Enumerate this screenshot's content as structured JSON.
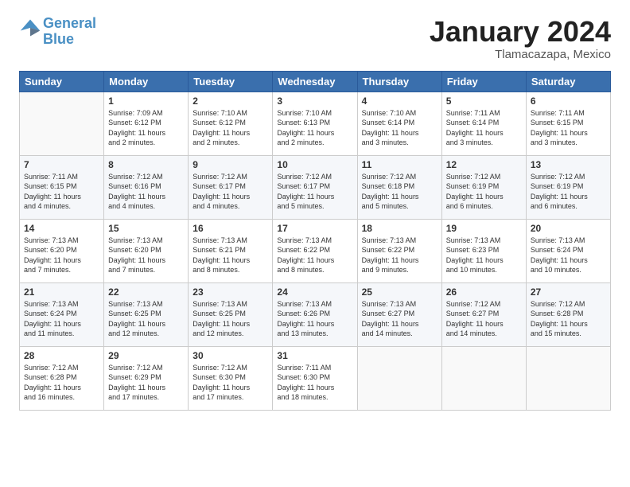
{
  "header": {
    "logo_line1": "General",
    "logo_line2": "Blue",
    "month_title": "January 2024",
    "location": "Tlamacazapa, Mexico"
  },
  "days_of_week": [
    "Sunday",
    "Monday",
    "Tuesday",
    "Wednesday",
    "Thursday",
    "Friday",
    "Saturday"
  ],
  "weeks": [
    [
      {
        "day": "",
        "content": ""
      },
      {
        "day": "1",
        "content": "Sunrise: 7:09 AM\nSunset: 6:12 PM\nDaylight: 11 hours\nand 2 minutes."
      },
      {
        "day": "2",
        "content": "Sunrise: 7:10 AM\nSunset: 6:12 PM\nDaylight: 11 hours\nand 2 minutes."
      },
      {
        "day": "3",
        "content": "Sunrise: 7:10 AM\nSunset: 6:13 PM\nDaylight: 11 hours\nand 2 minutes."
      },
      {
        "day": "4",
        "content": "Sunrise: 7:10 AM\nSunset: 6:14 PM\nDaylight: 11 hours\nand 3 minutes."
      },
      {
        "day": "5",
        "content": "Sunrise: 7:11 AM\nSunset: 6:14 PM\nDaylight: 11 hours\nand 3 minutes."
      },
      {
        "day": "6",
        "content": "Sunrise: 7:11 AM\nSunset: 6:15 PM\nDaylight: 11 hours\nand 3 minutes."
      }
    ],
    [
      {
        "day": "7",
        "content": "Sunrise: 7:11 AM\nSunset: 6:15 PM\nDaylight: 11 hours\nand 4 minutes."
      },
      {
        "day": "8",
        "content": "Sunrise: 7:12 AM\nSunset: 6:16 PM\nDaylight: 11 hours\nand 4 minutes."
      },
      {
        "day": "9",
        "content": "Sunrise: 7:12 AM\nSunset: 6:17 PM\nDaylight: 11 hours\nand 4 minutes."
      },
      {
        "day": "10",
        "content": "Sunrise: 7:12 AM\nSunset: 6:17 PM\nDaylight: 11 hours\nand 5 minutes."
      },
      {
        "day": "11",
        "content": "Sunrise: 7:12 AM\nSunset: 6:18 PM\nDaylight: 11 hours\nand 5 minutes."
      },
      {
        "day": "12",
        "content": "Sunrise: 7:12 AM\nSunset: 6:19 PM\nDaylight: 11 hours\nand 6 minutes."
      },
      {
        "day": "13",
        "content": "Sunrise: 7:12 AM\nSunset: 6:19 PM\nDaylight: 11 hours\nand 6 minutes."
      }
    ],
    [
      {
        "day": "14",
        "content": "Sunrise: 7:13 AM\nSunset: 6:20 PM\nDaylight: 11 hours\nand 7 minutes."
      },
      {
        "day": "15",
        "content": "Sunrise: 7:13 AM\nSunset: 6:20 PM\nDaylight: 11 hours\nand 7 minutes."
      },
      {
        "day": "16",
        "content": "Sunrise: 7:13 AM\nSunset: 6:21 PM\nDaylight: 11 hours\nand 8 minutes."
      },
      {
        "day": "17",
        "content": "Sunrise: 7:13 AM\nSunset: 6:22 PM\nDaylight: 11 hours\nand 8 minutes."
      },
      {
        "day": "18",
        "content": "Sunrise: 7:13 AM\nSunset: 6:22 PM\nDaylight: 11 hours\nand 9 minutes."
      },
      {
        "day": "19",
        "content": "Sunrise: 7:13 AM\nSunset: 6:23 PM\nDaylight: 11 hours\nand 10 minutes."
      },
      {
        "day": "20",
        "content": "Sunrise: 7:13 AM\nSunset: 6:24 PM\nDaylight: 11 hours\nand 10 minutes."
      }
    ],
    [
      {
        "day": "21",
        "content": "Sunrise: 7:13 AM\nSunset: 6:24 PM\nDaylight: 11 hours\nand 11 minutes."
      },
      {
        "day": "22",
        "content": "Sunrise: 7:13 AM\nSunset: 6:25 PM\nDaylight: 11 hours\nand 12 minutes."
      },
      {
        "day": "23",
        "content": "Sunrise: 7:13 AM\nSunset: 6:25 PM\nDaylight: 11 hours\nand 12 minutes."
      },
      {
        "day": "24",
        "content": "Sunrise: 7:13 AM\nSunset: 6:26 PM\nDaylight: 11 hours\nand 13 minutes."
      },
      {
        "day": "25",
        "content": "Sunrise: 7:13 AM\nSunset: 6:27 PM\nDaylight: 11 hours\nand 14 minutes."
      },
      {
        "day": "26",
        "content": "Sunrise: 7:12 AM\nSunset: 6:27 PM\nDaylight: 11 hours\nand 14 minutes."
      },
      {
        "day": "27",
        "content": "Sunrise: 7:12 AM\nSunset: 6:28 PM\nDaylight: 11 hours\nand 15 minutes."
      }
    ],
    [
      {
        "day": "28",
        "content": "Sunrise: 7:12 AM\nSunset: 6:28 PM\nDaylight: 11 hours\nand 16 minutes."
      },
      {
        "day": "29",
        "content": "Sunrise: 7:12 AM\nSunset: 6:29 PM\nDaylight: 11 hours\nand 17 minutes."
      },
      {
        "day": "30",
        "content": "Sunrise: 7:12 AM\nSunset: 6:30 PM\nDaylight: 11 hours\nand 17 minutes."
      },
      {
        "day": "31",
        "content": "Sunrise: 7:11 AM\nSunset: 6:30 PM\nDaylight: 11 hours\nand 18 minutes."
      },
      {
        "day": "",
        "content": ""
      },
      {
        "day": "",
        "content": ""
      },
      {
        "day": "",
        "content": ""
      }
    ]
  ]
}
